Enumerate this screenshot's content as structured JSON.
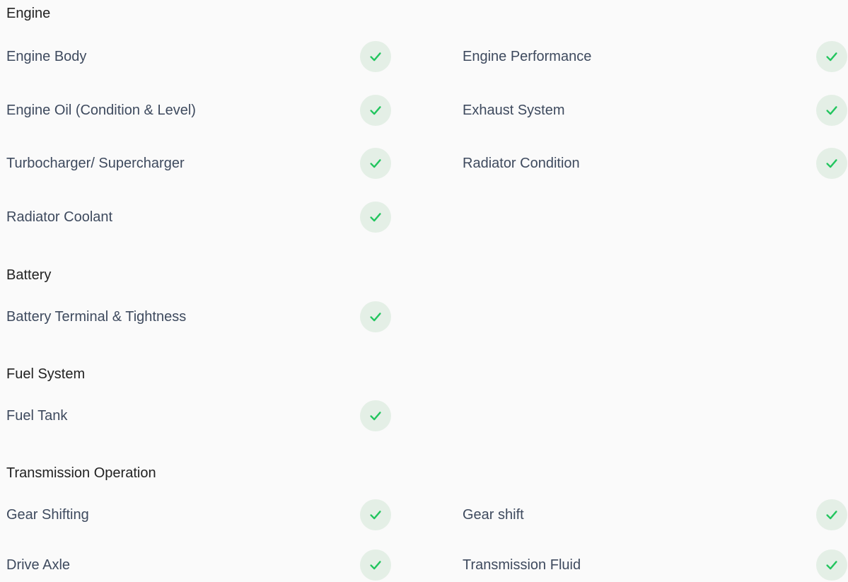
{
  "colors": {
    "check_stroke": "#22c55e",
    "check_bg": "#e4efe6",
    "label_text": "#3e4a5e",
    "heading_text": "#222222"
  },
  "sections": [
    {
      "title": "Engine",
      "rows": [
        [
          {
            "label": "Engine Body",
            "status": "passed",
            "icon": "check-icon"
          },
          {
            "label": "Engine Performance",
            "status": "passed",
            "icon": "check-icon"
          }
        ],
        [
          {
            "label": "Engine Oil (Condition & Level)",
            "status": "passed",
            "icon": "check-icon"
          },
          {
            "label": "Exhaust System",
            "status": "passed",
            "icon": "check-icon"
          }
        ],
        [
          {
            "label": "Turbocharger/ Supercharger",
            "status": "passed",
            "icon": "check-icon"
          },
          {
            "label": "Radiator Condition",
            "status": "passed",
            "icon": "check-icon"
          }
        ],
        [
          {
            "label": "Radiator Coolant",
            "status": "passed",
            "icon": "check-icon"
          }
        ]
      ]
    },
    {
      "title": "Battery",
      "rows": [
        [
          {
            "label": "Battery Terminal & Tightness",
            "status": "passed",
            "icon": "check-icon"
          }
        ]
      ]
    },
    {
      "title": "Fuel System",
      "rows": [
        [
          {
            "label": "Fuel Tank",
            "status": "passed",
            "icon": "check-icon"
          }
        ]
      ]
    },
    {
      "title": "Transmission Operation",
      "rows": [
        [
          {
            "label": "Gear Shifting",
            "status": "passed",
            "icon": "check-icon"
          },
          {
            "label": "Gear shift",
            "status": "passed",
            "icon": "check-icon"
          }
        ],
        [
          {
            "label": "Drive Axle",
            "status": "passed",
            "icon": "check-icon"
          },
          {
            "label": "Transmission Fluid",
            "status": "passed",
            "icon": "check-icon"
          }
        ]
      ]
    }
  ]
}
